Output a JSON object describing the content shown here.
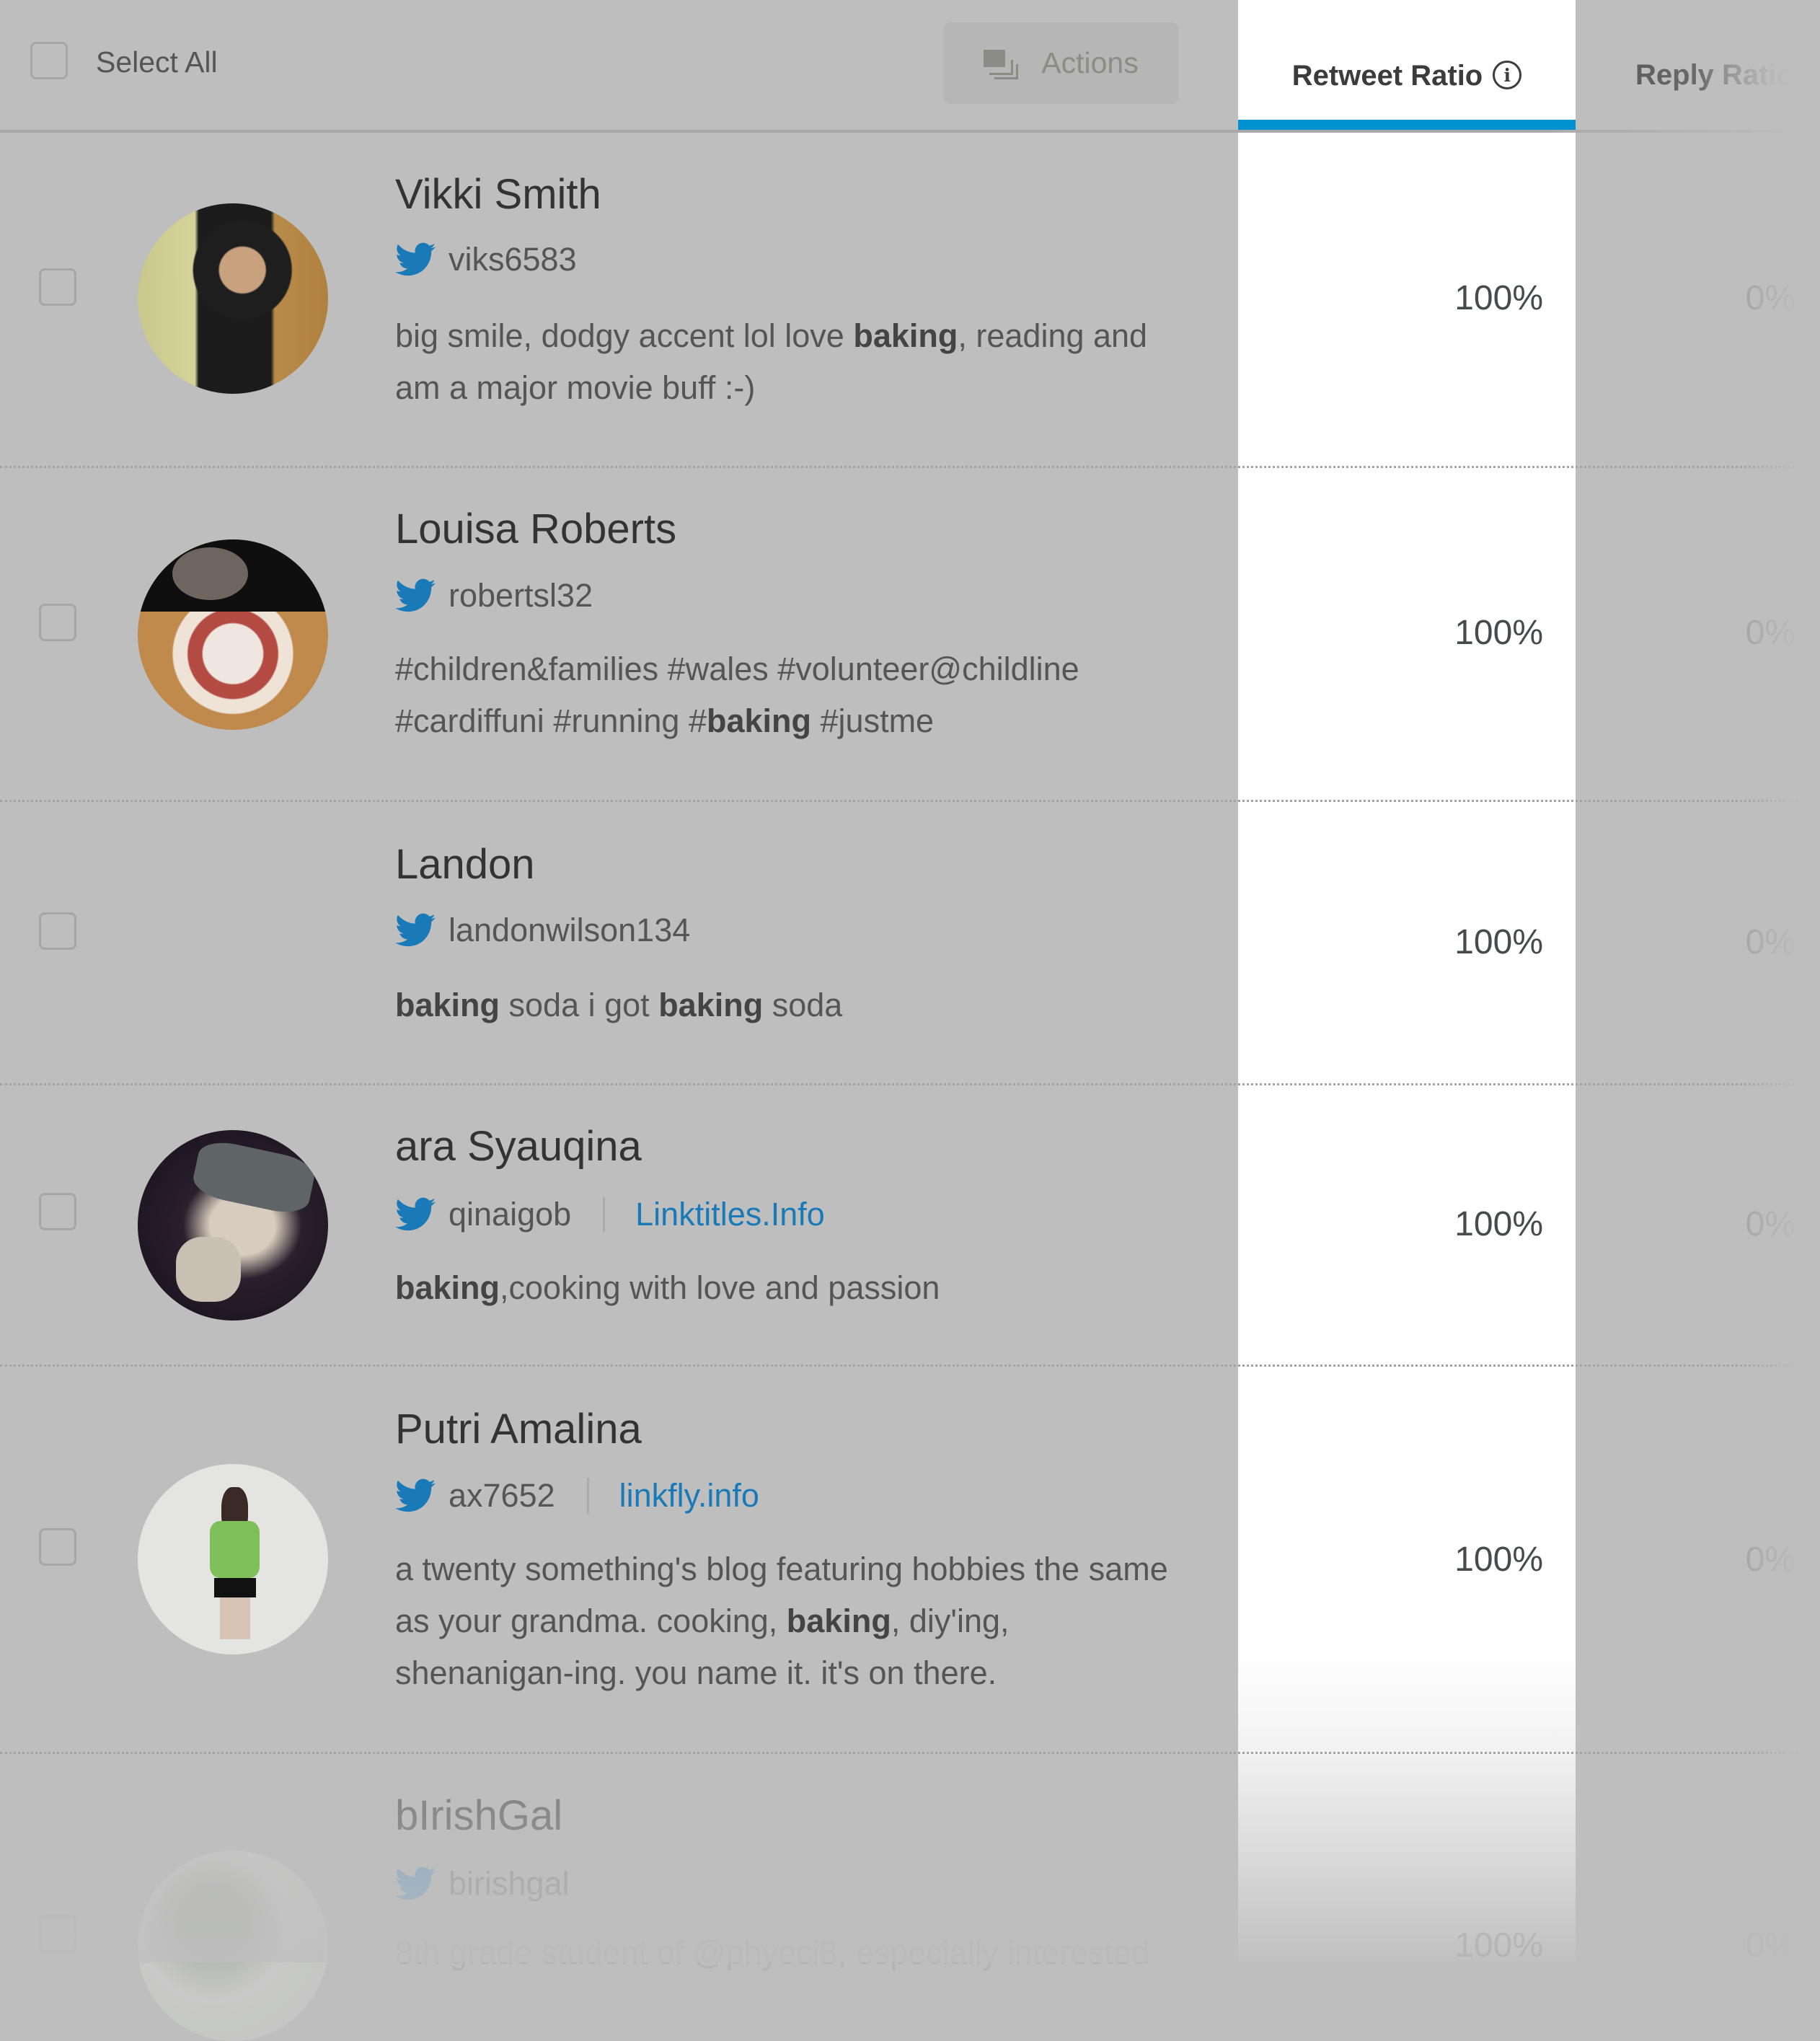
{
  "header": {
    "select_all_label": "Select All",
    "actions_label": "Actions",
    "actions_icon": "stack-icon"
  },
  "columns": {
    "retweet_ratio": {
      "label": "Retweet Ratio",
      "info_icon": "info-icon",
      "active": true
    },
    "reply_ratio": {
      "label": "Reply Ratio",
      "active": false
    }
  },
  "colors": {
    "accent": "#0091d0",
    "twitter_blue": "#1a7ab8",
    "link": "#1a7ab8",
    "overlay_bg": "#bebebe"
  },
  "rows": [
    {
      "name": "Vikki Smith",
      "handle": "viks6583",
      "link": null,
      "bio_parts": [
        {
          "text": "big smile, dodgy accent lol love ",
          "bold": false
        },
        {
          "text": "baking",
          "bold": true
        },
        {
          "text": ", reading and am a major movie buff :-)",
          "bold": false
        }
      ],
      "retweet_ratio": "100%",
      "reply_ratio": "0%",
      "has_avatar": true
    },
    {
      "name": "Louisa Roberts",
      "handle": "robertsl32",
      "link": null,
      "bio_parts": [
        {
          "text": "#children&families #wales #volunteer@childline #cardiffuni #running #",
          "bold": false
        },
        {
          "text": "baking",
          "bold": true
        },
        {
          "text": " #justme",
          "bold": false
        }
      ],
      "retweet_ratio": "100%",
      "reply_ratio": "0%",
      "has_avatar": true
    },
    {
      "name": "Landon",
      "handle": "landonwilson134",
      "link": null,
      "bio_parts": [
        {
          "text": "baking",
          "bold": true
        },
        {
          "text": " soda i got ",
          "bold": false
        },
        {
          "text": "baking",
          "bold": true
        },
        {
          "text": " soda",
          "bold": false
        }
      ],
      "retweet_ratio": "100%",
      "reply_ratio": "0%",
      "has_avatar": false
    },
    {
      "name": "ara Syauqina",
      "handle": "qinaigob",
      "link": "Linktitles.Info",
      "bio_parts": [
        {
          "text": "baking",
          "bold": true
        },
        {
          "text": ",cooking with love and passion",
          "bold": false
        }
      ],
      "retweet_ratio": "100%",
      "reply_ratio": "0%",
      "has_avatar": true
    },
    {
      "name": "Putri Amalina",
      "handle": "ax7652",
      "link": "linkfly.info",
      "bio_parts": [
        {
          "text": "a twenty something's blog featuring hobbies the same as your grandma. cooking, ",
          "bold": false
        },
        {
          "text": "baking",
          "bold": true
        },
        {
          "text": ", diy'ing, shenanigan-ing. you name it. it's on there.",
          "bold": false
        }
      ],
      "retweet_ratio": "100%",
      "reply_ratio": "0%",
      "has_avatar": true
    },
    {
      "name": "bIrishGal",
      "handle": "birishgal",
      "link": null,
      "bio_parts": [
        {
          "text": "8th grade student of @phyeci8, especially interested",
          "bold": false
        }
      ],
      "retweet_ratio": "100%",
      "reply_ratio": "0%",
      "has_avatar": true
    }
  ]
}
